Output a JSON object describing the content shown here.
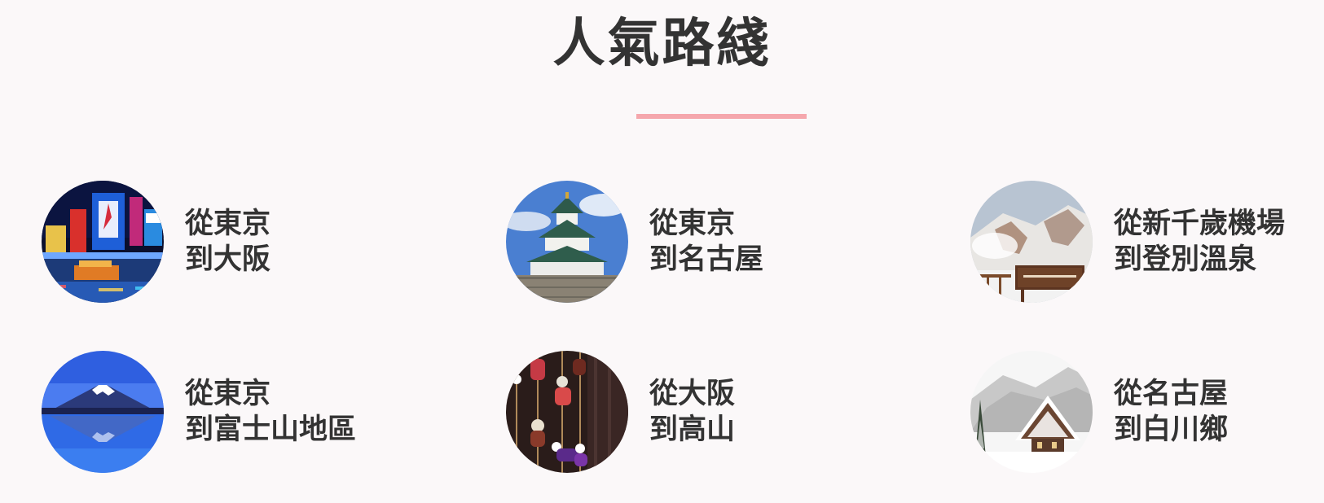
{
  "section": {
    "title": "人氣路綫"
  },
  "colors": {
    "background": "#fbf8f9",
    "accent_underline": "#f5a7ad",
    "text": "#333333"
  },
  "routes": [
    {
      "line1": "從東京",
      "line2": "到大阪",
      "image": "osaka-dotonbori-night-photo"
    },
    {
      "line1": "從東京",
      "line2": "到名古屋",
      "image": "nagoya-castle-photo"
    },
    {
      "line1": "從新千歲機場",
      "line2": "到登別溫泉",
      "image": "noboribetsu-jigokudani-snow-photo"
    },
    {
      "line1": "從東京",
      "line2": "到富士山地區",
      "image": "mount-fuji-lake-reflection-photo"
    },
    {
      "line1": "從大阪",
      "line2": "到高山",
      "image": "takayama-sarubobo-dolls-photo"
    },
    {
      "line1": "從名古屋",
      "line2": "到白川鄉",
      "image": "shirakawago-snow-house-photo"
    }
  ]
}
